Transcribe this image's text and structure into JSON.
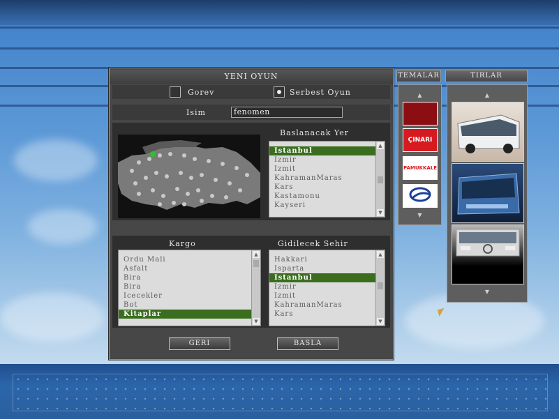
{
  "dialog": {
    "title": "YENI OYUN",
    "mode_options": [
      {
        "label": "Gorev",
        "selected": false
      },
      {
        "label": "Serbest Oyun",
        "selected": true
      }
    ],
    "name_label": "Isim",
    "name_value": "fenomen",
    "start_location": {
      "label": "Baslanacak Yer",
      "items": [
        "Istanbul",
        "Izmir",
        "Izmit",
        "KahramanMaras",
        "Kars",
        "Kastamonu",
        "Kayseri"
      ],
      "selected": "Istanbul"
    },
    "cargo": {
      "label": "Kargo",
      "items": [
        "Ordu Mali",
        "Asfalt",
        "Bira",
        "Bira",
        "Icecekler",
        "Bot",
        "Kitaplar"
      ],
      "selected": "Kitaplar"
    },
    "destination": {
      "label": "Gidilecek Sehir",
      "items": [
        "Hakkari",
        "Isparta",
        "Istanbul",
        "Izmir",
        "Izmit",
        "KahramanMaras",
        "Kars"
      ],
      "selected": "Istanbul"
    },
    "back_button": "GERI",
    "start_button": "BASLA"
  },
  "themes": {
    "label": "TEMALAR",
    "items": [
      {
        "name": "red-theme",
        "color": "#8b0f12",
        "text": ""
      },
      {
        "name": "cinari-theme",
        "color": "#d71920",
        "text": "ÇINARI"
      },
      {
        "name": "pamukkale-theme",
        "color": "#ffffff",
        "text": "PAMUKKALE"
      },
      {
        "name": "blue-logo-theme",
        "color": "#ffffff",
        "text": ""
      }
    ]
  },
  "trucks": {
    "label": "TIRLAR",
    "items": [
      "bus-white",
      "bus-blue",
      "bus-silver"
    ]
  },
  "colors": {
    "selection": "#3a6e1e",
    "map_land": "#7a7a7a",
    "map_marker": "#2fbf2f"
  }
}
